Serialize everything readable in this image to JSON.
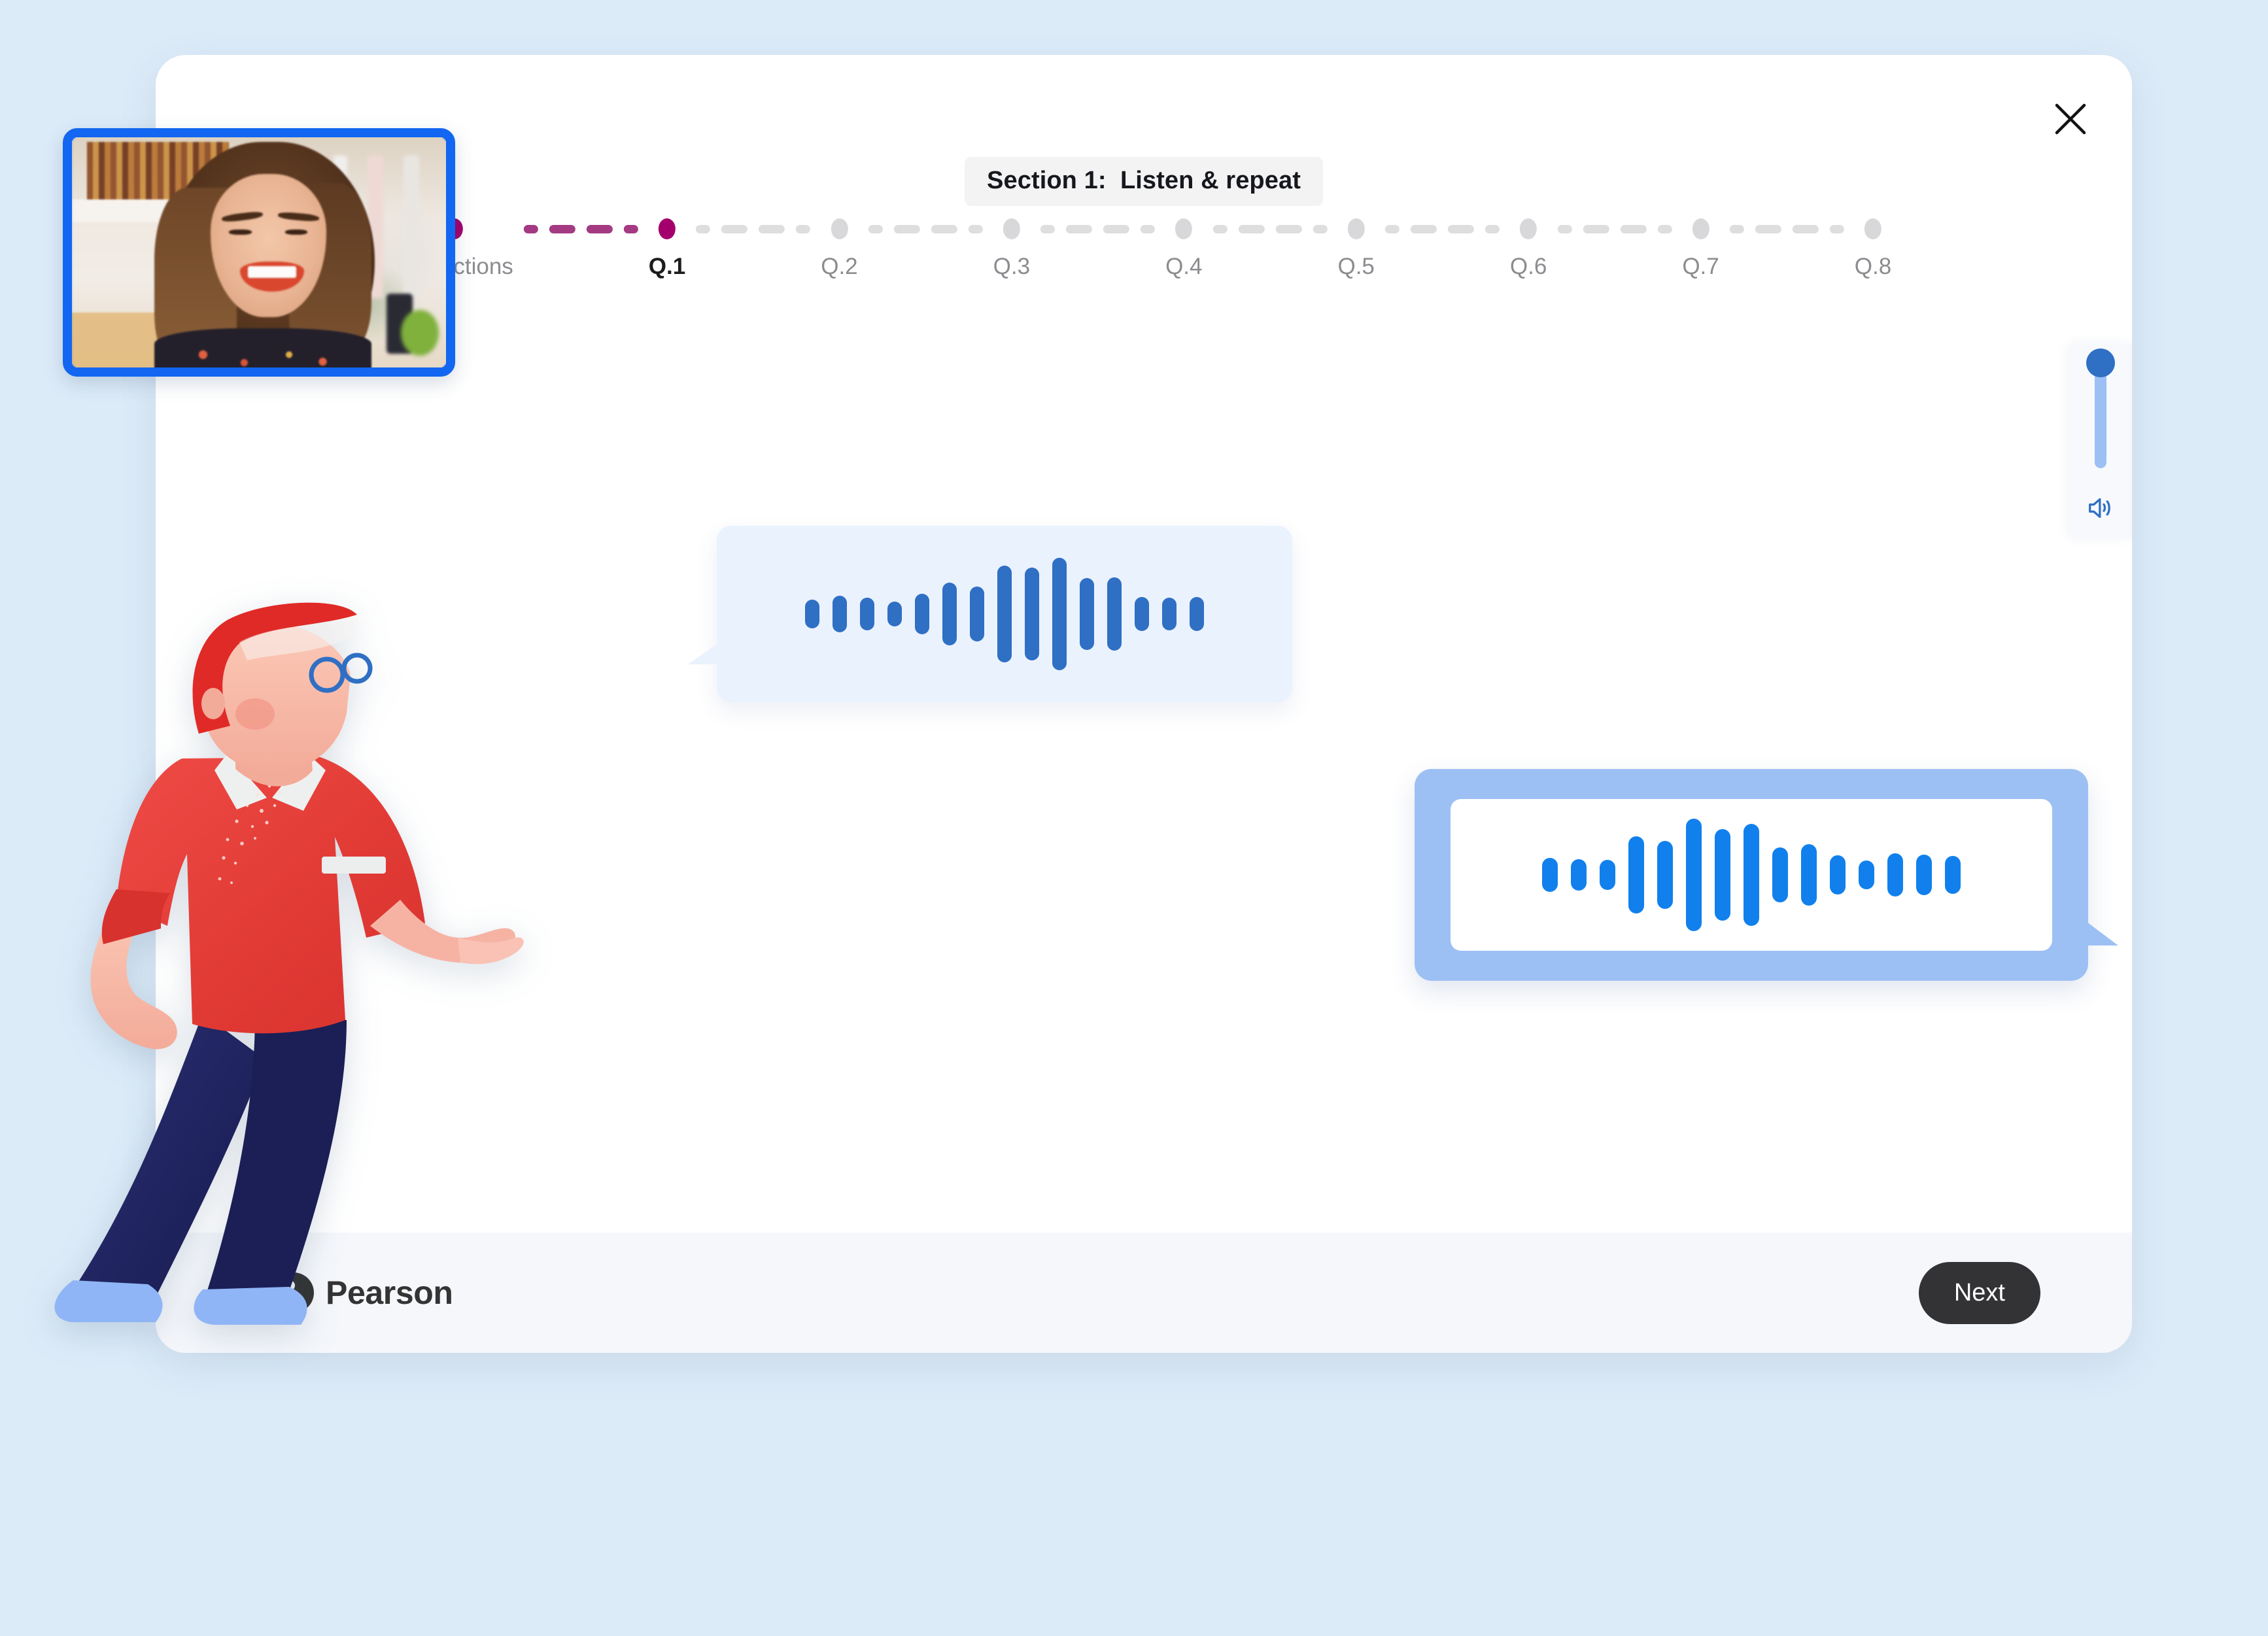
{
  "app": {
    "background_color": "#dcebf8",
    "card_color": "#ffffff"
  },
  "header": {
    "section_label": "Section 1:  Listen & repeat",
    "close_icon": "close-icon"
  },
  "stepper": {
    "accent_done_color": "#a4006d",
    "accent_idle_color": "#d8d8da",
    "steps": [
      {
        "label": "Instructions",
        "state": "done"
      },
      {
        "label": "Q.1",
        "state": "current"
      },
      {
        "label": "Q.2",
        "state": "upcoming"
      },
      {
        "label": "Q.3",
        "state": "upcoming"
      },
      {
        "label": "Q.4",
        "state": "upcoming"
      },
      {
        "label": "Q.5",
        "state": "upcoming"
      },
      {
        "label": "Q.6",
        "state": "upcoming"
      },
      {
        "label": "Q.7",
        "state": "upcoming"
      },
      {
        "label": "Q.8",
        "state": "upcoming"
      }
    ]
  },
  "webcam": {
    "name": "self-view-video",
    "border_color": "#1266f1"
  },
  "volume": {
    "name": "volume-slider",
    "value_percent": 96,
    "fill_color": "#9cc0f5",
    "thumb_color": "#2f6fc4",
    "icon": "speaker-icon"
  },
  "prompt_audio": {
    "name": "prompt-audio-bubble",
    "bubble_color": "#eaf2fd",
    "bar_color": "#2f6fc4",
    "bars": [
      44,
      56,
      50,
      38,
      62,
      96,
      84,
      148,
      142,
      172,
      110,
      112,
      52,
      50,
      52
    ]
  },
  "response_audio": {
    "name": "response-audio-bubble",
    "frame_color": "#9dc0f4",
    "inner_color": "#ffffff",
    "bar_color": "#1180ec",
    "bars": [
      52,
      48,
      46,
      118,
      104,
      172,
      140,
      156,
      84,
      94,
      60,
      44,
      66,
      62,
      58
    ]
  },
  "footer": {
    "brand": "Pearson",
    "next_label": "Next"
  }
}
